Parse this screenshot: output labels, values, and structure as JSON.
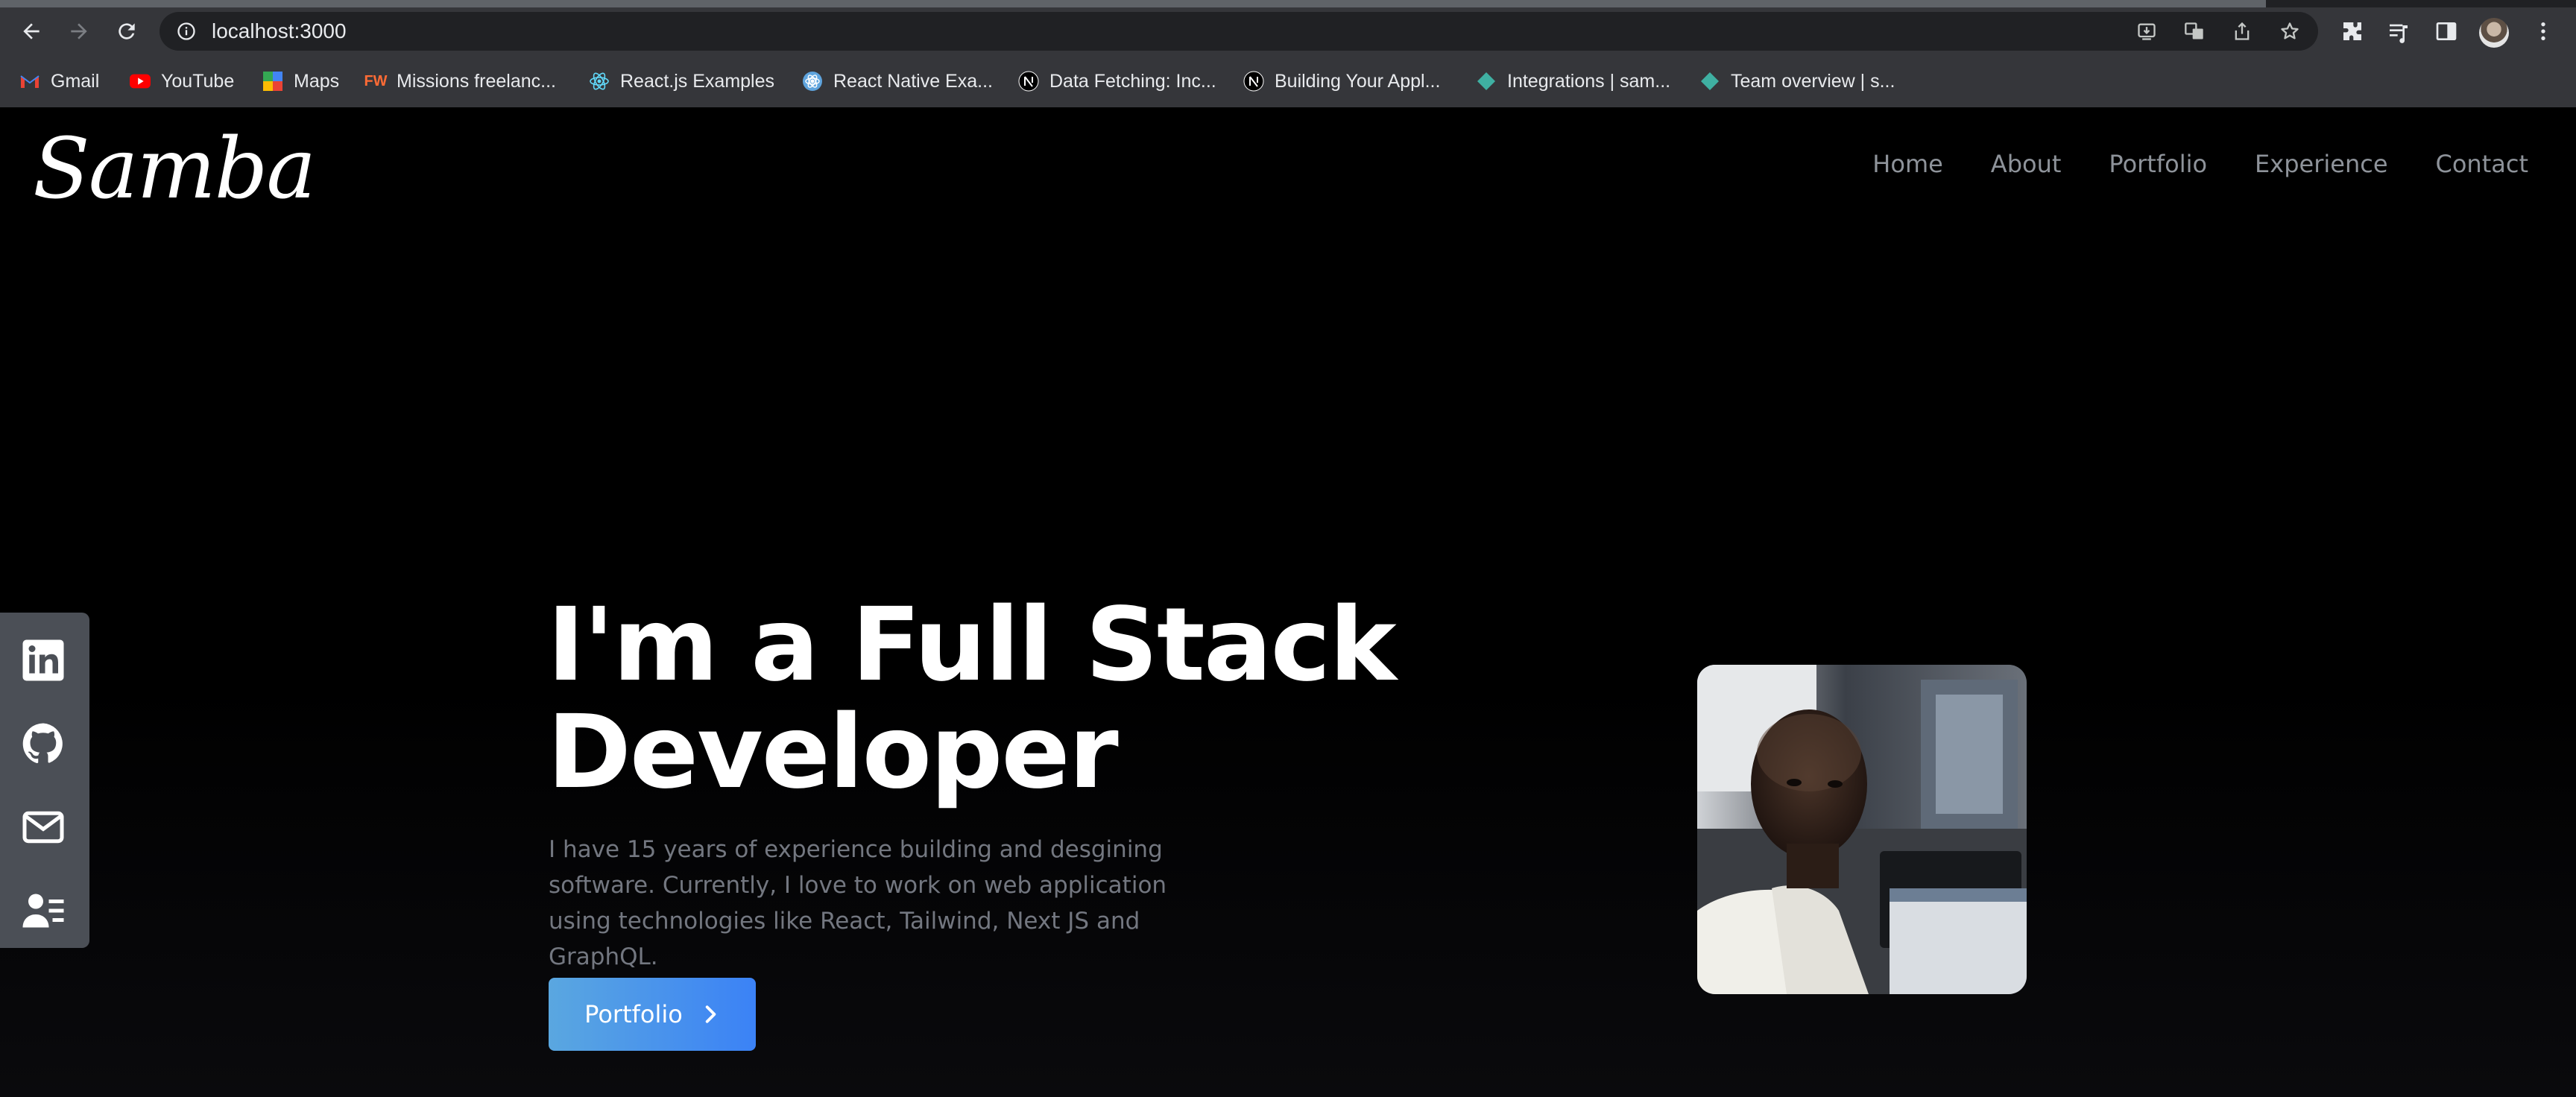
{
  "browser": {
    "url": "localhost:3000",
    "bookmarks": [
      {
        "label": "Gmail",
        "icon": "gmail-icon"
      },
      {
        "label": "YouTube",
        "icon": "youtube-icon"
      },
      {
        "label": "Maps",
        "icon": "maps-icon"
      },
      {
        "label": "Missions freelanc...",
        "icon": "freelance-icon"
      },
      {
        "label": "React.js Examples",
        "icon": "react-icon"
      },
      {
        "label": "React Native Exa...",
        "icon": "react-native-icon"
      },
      {
        "label": "Data Fetching: Inc...",
        "icon": "nextjs-icon"
      },
      {
        "label": "Building Your Appl...",
        "icon": "nextjs-icon"
      },
      {
        "label": "Integrations | sam...",
        "icon": "diamond-icon"
      },
      {
        "label": "Team overview | s...",
        "icon": "diamond-icon"
      }
    ]
  },
  "site": {
    "logo": "Samba",
    "nav": [
      "Home",
      "About",
      "Portfolio",
      "Experience",
      "Contact"
    ]
  },
  "hero": {
    "title_line1": "I'm a Full Stack",
    "title_line2": "Developer",
    "description": "I have 15 years of experience building and desgining software. Currently, I love to work on web application using technologies like React, Tailwind, Next JS and GraphQL.",
    "button_label": "Portfolio"
  },
  "social": [
    "linkedin-icon",
    "github-icon",
    "mail-icon",
    "resume-icon"
  ],
  "colors": {
    "page_bg": "#000000",
    "nav_text": "#8e939a",
    "button_gradient_start": "#5aa7e0",
    "button_gradient_end": "#3b82f6",
    "social_bar": "#4b4f56"
  }
}
